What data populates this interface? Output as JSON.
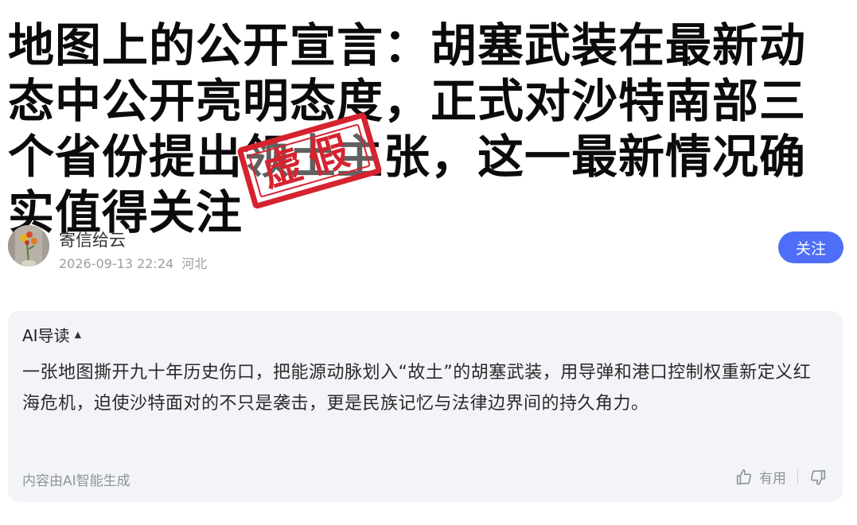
{
  "article": {
    "title": "地图上的公开宣言：胡塞武装在最新动态中公开亮明态度，正式对沙特南部三个省份提出领土主张，这一最新情况确实值得关注"
  },
  "stamp": {
    "text": "虚假",
    "color": "#d5232f"
  },
  "author": {
    "name": "寄信给云",
    "datetime": "2026-09-13 22:24",
    "region": "河北",
    "follow_label": "关注"
  },
  "ai_summary": {
    "header": "AI导读",
    "text": "一张地图撕开九十年历史伤口，把能源动脉划入“故土”的胡塞武装，用导弹和港口控制权重新定义红海危机，迫使沙特面对的不只是袭击，更是民族记忆与法律边界间的持久角力。",
    "source_note": "内容由AI智能生成",
    "useful_label": "有用"
  },
  "colors": {
    "accent": "#4f6ef7",
    "card_bg": "#f3f4f8"
  }
}
